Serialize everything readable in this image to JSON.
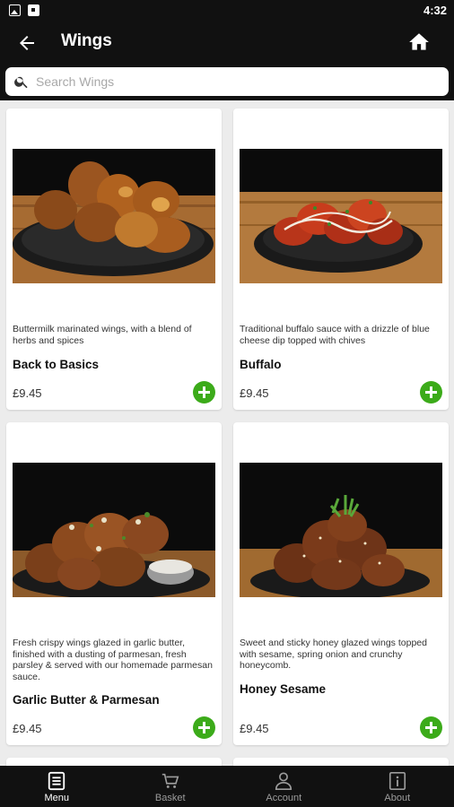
{
  "status_bar": {
    "time": "4:32",
    "icons": [
      "image-icon",
      "app-icon"
    ]
  },
  "app_bar": {
    "title": "Wings",
    "back_icon": "arrow-left-icon",
    "home_icon": "home-icon"
  },
  "search": {
    "placeholder": "Search Wings",
    "value": ""
  },
  "products": [
    {
      "description": "Buttermilk marinated wings, with a blend of herbs and spices",
      "name": "Back to Basics",
      "price": "£9.45"
    },
    {
      "description": "Traditional buffalo sauce with a drizzle of blue cheese dip topped with chives",
      "name": "Buffalo",
      "price": "£9.45"
    },
    {
      "description": "Fresh crispy wings glazed in garlic butter, finished with a dusting of parmesan, fresh parsley & served with our homemade parmesan sauce.",
      "name": "Garlic Butter & Parmesan",
      "price": "£9.45"
    },
    {
      "description": "Sweet and sticky honey glazed wings topped with sesame, spring onion and crunchy honeycomb.",
      "name": "Honey Sesame",
      "price": "£9.45"
    }
  ],
  "bottom_nav": [
    {
      "label": "Menu",
      "icon": "menu-icon",
      "active": true
    },
    {
      "label": "Basket",
      "icon": "basket-icon",
      "active": false
    },
    {
      "label": "Account",
      "icon": "account-icon",
      "active": false
    },
    {
      "label": "About",
      "icon": "about-icon",
      "active": false
    }
  ],
  "colors": {
    "bar": "#111111",
    "background": "#ececec",
    "add_button": "#3cab1a",
    "card": "#ffffff"
  }
}
